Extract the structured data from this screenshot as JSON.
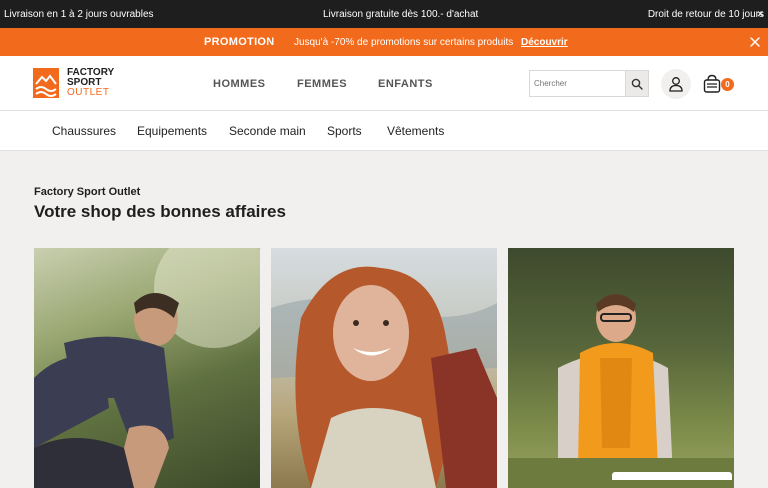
{
  "topbar": {
    "left": "Livraison en 1 à 2 jours ouvrables",
    "center": "Livraison gratuite dès 100.- d'achat",
    "right": "Droit de retour de 10 jours"
  },
  "promo": {
    "title": "PROMOTION",
    "text": "Jusqu'à -70% de promotions sur certains produits",
    "link": "Découvrir"
  },
  "logo": {
    "line1": "FACTORY",
    "line2": "SPORT",
    "line3": "OUTLET"
  },
  "main_nav": [
    "HOMMES",
    "FEMMES",
    "ENFANTS"
  ],
  "search": {
    "placeholder": "Chercher"
  },
  "cart": {
    "count": "0"
  },
  "sub_nav": [
    "Chaussures",
    "Equipements",
    "Seconde main",
    "Sports",
    "Vêtements"
  ],
  "hero": {
    "eyebrow": "Factory Sport Outlet",
    "title": "Votre shop des bonnes affaires"
  },
  "icons": {
    "search": "search-icon",
    "account": "user-icon",
    "cart": "basket-icon",
    "close": "close-icon"
  },
  "colors": {
    "accent": "#f26a1c",
    "topbar": "#1e1e1e",
    "page_bg": "#f2f0ee"
  }
}
